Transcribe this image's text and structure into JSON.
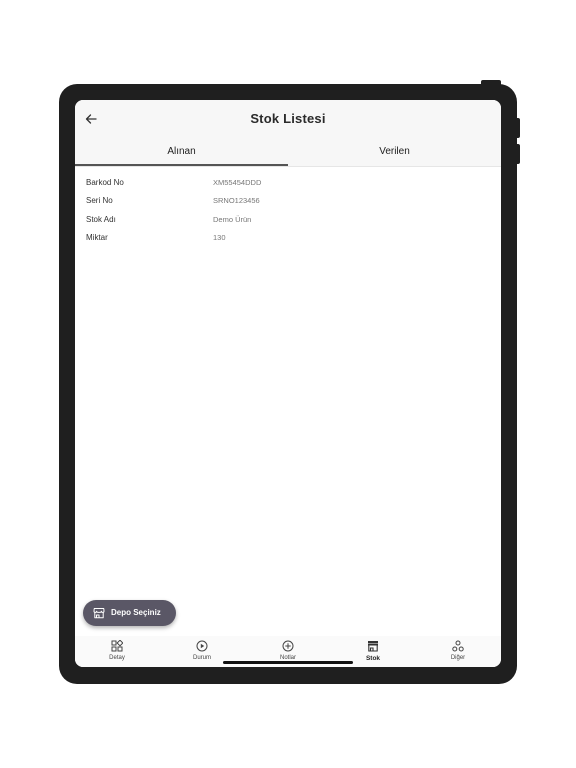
{
  "header": {
    "title": "Stok Listesi",
    "back_icon": "arrow-left-icon"
  },
  "tabs": [
    {
      "label": "Alınan",
      "active": true
    },
    {
      "label": "Verilen",
      "active": false
    }
  ],
  "details": [
    {
      "label": "Barkod No",
      "value": "XM55454DDD"
    },
    {
      "label": "Seri No",
      "value": "SRNO123456"
    },
    {
      "label": "Stok Adı",
      "value": "Demo Ürün"
    },
    {
      "label": "Miktar",
      "value": "130"
    }
  ],
  "fab": {
    "label": "Depo Seçiniz",
    "icon": "store-icon",
    "color": "#5a5766"
  },
  "bottom_nav": [
    {
      "label": "Detay",
      "icon": "grid-icon",
      "active": false
    },
    {
      "label": "Durum",
      "icon": "play-circle-icon",
      "active": false
    },
    {
      "label": "Notlar",
      "icon": "plus-circle-icon",
      "active": false
    },
    {
      "label": "Stok",
      "icon": "store-icon",
      "active": true
    },
    {
      "label": "Diğer",
      "icon": "nodes-icon",
      "active": false
    }
  ]
}
